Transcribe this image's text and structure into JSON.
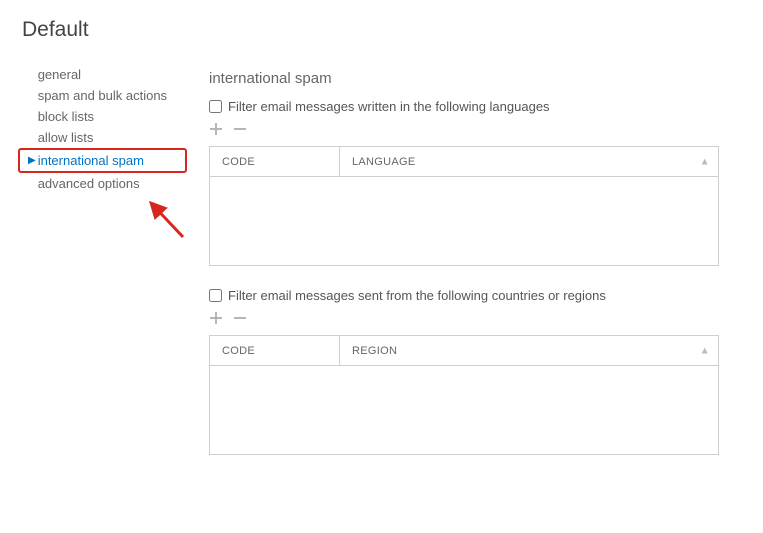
{
  "page_title": "Default",
  "sidebar": {
    "items": [
      {
        "label": "general",
        "selected": false
      },
      {
        "label": "spam and bulk actions",
        "selected": false
      },
      {
        "label": "block lists",
        "selected": false
      },
      {
        "label": "allow lists",
        "selected": false
      },
      {
        "label": "international spam",
        "selected": true,
        "highlighted": true
      },
      {
        "label": "advanced options",
        "selected": false
      }
    ]
  },
  "main": {
    "section_title": "international spam",
    "language_filter": {
      "checkbox_label": "Filter email messages written in the following languages",
      "columns": {
        "code": "CODE",
        "name": "LANGUAGE"
      }
    },
    "region_filter": {
      "checkbox_label": "Filter email messages sent from the following countries or regions",
      "columns": {
        "code": "CODE",
        "name": "REGION"
      }
    }
  }
}
